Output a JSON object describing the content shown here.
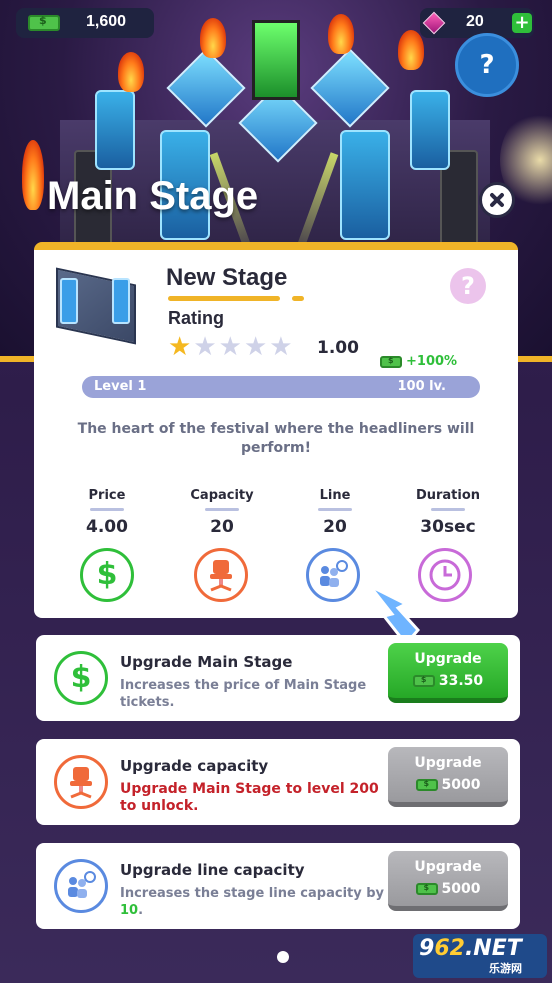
{
  "hud": {
    "cash": "1,600",
    "gems": "20",
    "plus_label": "+",
    "help_label": "?"
  },
  "title": "Main Stage",
  "stage": {
    "name": "New Stage",
    "rating_label": "Rating",
    "rating_value": "1.00",
    "stars_filled": 1,
    "stars_total": 5,
    "help_label": "?",
    "bonus": "+100%",
    "level_left": "Level 1",
    "level_right": "100 lv.",
    "description": "The heart of the festival where the headliners will perform!"
  },
  "stats": [
    {
      "label": "Price",
      "value": "4.00",
      "icon": "dollar-icon",
      "color": "#2fbf3a"
    },
    {
      "label": "Capacity",
      "value": "20",
      "icon": "chair-icon",
      "color": "#f06a3a"
    },
    {
      "label": "Line",
      "value": "20",
      "icon": "queue-icon",
      "color": "#5a8ae0"
    },
    {
      "label": "Duration",
      "value": "30sec",
      "icon": "clock-icon",
      "color": "#c86ad8"
    }
  ],
  "upgrades": [
    {
      "title": "Upgrade Main Stage",
      "desc": "Increases the price of Main Stage tickets.",
      "button": "Upgrade",
      "cost": "33.50",
      "enabled": true
    },
    {
      "title": "Upgrade capacity",
      "desc": "Upgrade Main Stage to level 200 to unlock.",
      "button": "Upgrade",
      "cost": "5000",
      "enabled": false
    },
    {
      "title": "Upgrade line capacity",
      "desc_prefix": "Increases the stage line capacity by ",
      "desc_highlight": "10",
      "desc_suffix": ".",
      "button": "Upgrade",
      "cost": "5000",
      "enabled": false
    }
  ],
  "watermark": {
    "brand_a": "9",
    "brand_b": "62",
    "brand_c": ".NET",
    "sub": "乐游网"
  },
  "colors": {
    "gold": "#f0b428",
    "green": "#2fbf3a",
    "lock_red": "#c4222a"
  }
}
